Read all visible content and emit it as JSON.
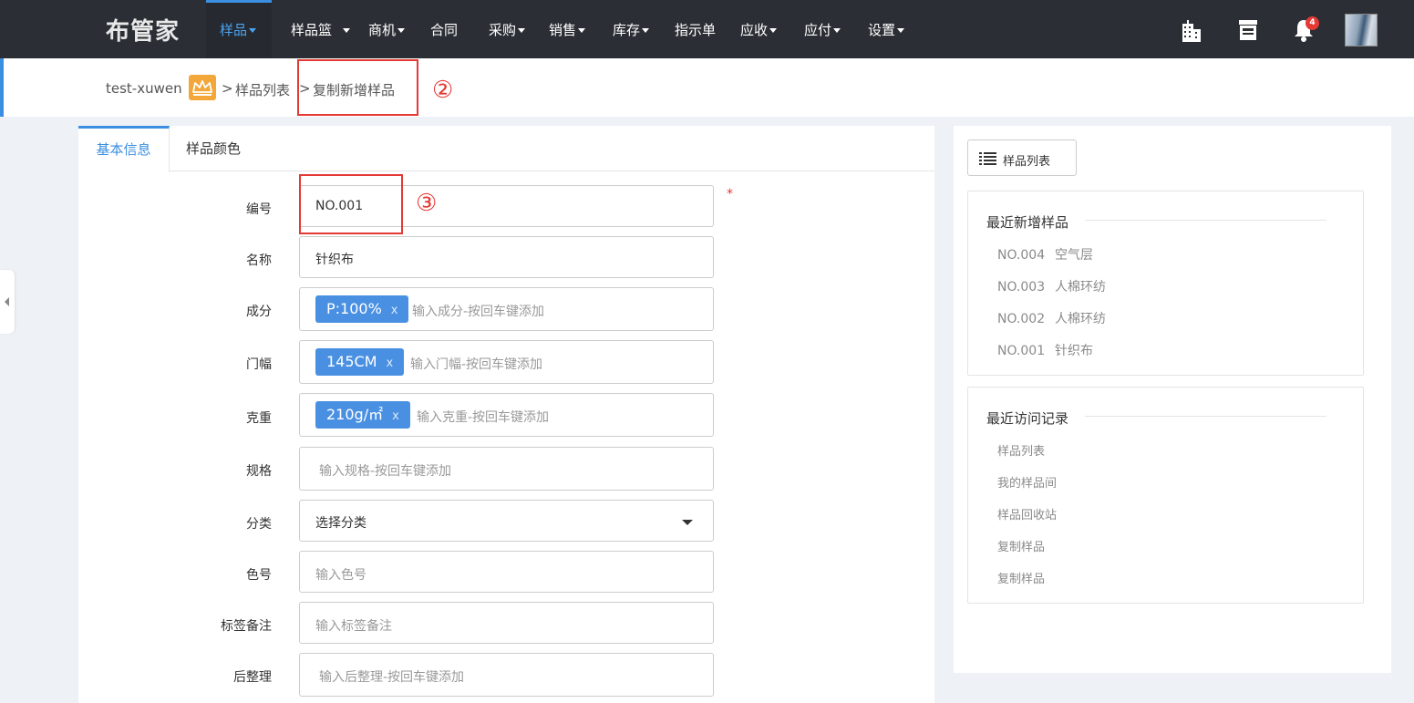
{
  "app": {
    "logo": "布管家"
  },
  "nav": [
    {
      "label": "样品",
      "caret": true,
      "active": true
    },
    {
      "label": "样品篮",
      "caret": true
    },
    {
      "label": "商机",
      "caret": true
    },
    {
      "label": "合同",
      "caret": false
    },
    {
      "label": "采购",
      "caret": true
    },
    {
      "label": "销售",
      "caret": true
    },
    {
      "label": "库存",
      "caret": true
    },
    {
      "label": "指示单",
      "caret": false
    },
    {
      "label": "应收",
      "caret": true
    },
    {
      "label": "应付",
      "caret": true
    },
    {
      "label": "设置",
      "caret": true
    }
  ],
  "nav_right": {
    "building_icon": "building-icon",
    "store_icon": "store-icon",
    "bell_icon": "bell-icon",
    "notification_count": "4"
  },
  "breadcrumb": {
    "user": "test-xuwen",
    "sep1": ">",
    "list": "样品列表",
    "sep2": ">",
    "current": "复制新增样品"
  },
  "annotations": {
    "two": "②",
    "three": "③"
  },
  "tabs": {
    "basic": "基本信息",
    "color": "样品颜色"
  },
  "form": {
    "code": {
      "label": "编号",
      "value": "NO.001",
      "required": "*"
    },
    "name": {
      "label": "名称",
      "value": "针织布"
    },
    "composition": {
      "label": "成分",
      "tag": "P:100%",
      "remove": "x",
      "placeholder": "输入成分-按回车键添加"
    },
    "width": {
      "label": "门幅",
      "tag": "145CM",
      "remove": "x",
      "placeholder": "输入门幅-按回车键添加"
    },
    "weight": {
      "label": "克重",
      "tag": "210g/㎡",
      "remove": "x",
      "placeholder": "输入克重-按回车键添加"
    },
    "spec": {
      "label": "规格",
      "placeholder": "输入规格-按回车键添加"
    },
    "category": {
      "label": "分类",
      "value": "选择分类"
    },
    "color_no": {
      "label": "色号",
      "placeholder": "输入色号"
    },
    "tag_note": {
      "label": "标签备注",
      "placeholder": "输入标签备注"
    },
    "finishing": {
      "label": "后整理",
      "placeholder": "输入后整理-按回车键添加"
    }
  },
  "right": {
    "list_button": "样品列表",
    "recent_title": "最近新增样品",
    "recent": [
      {
        "code": "NO.004",
        "name": "空气层"
      },
      {
        "code": "NO.003",
        "name": "人棉环纺"
      },
      {
        "code": "NO.002",
        "name": "人棉环纺"
      },
      {
        "code": "NO.001",
        "name": "针织布"
      }
    ],
    "visit_title": "最近访问记录",
    "visits": [
      "样品列表",
      "我的样品间",
      "样品回收站",
      "复制样品",
      "复制样品"
    ]
  },
  "colors": {
    "nav_bg": "#2b2f35",
    "accent": "#3b8fe0",
    "tag": "#4a90e2",
    "annotation": "#e53935",
    "crown": "#f3a73b"
  }
}
